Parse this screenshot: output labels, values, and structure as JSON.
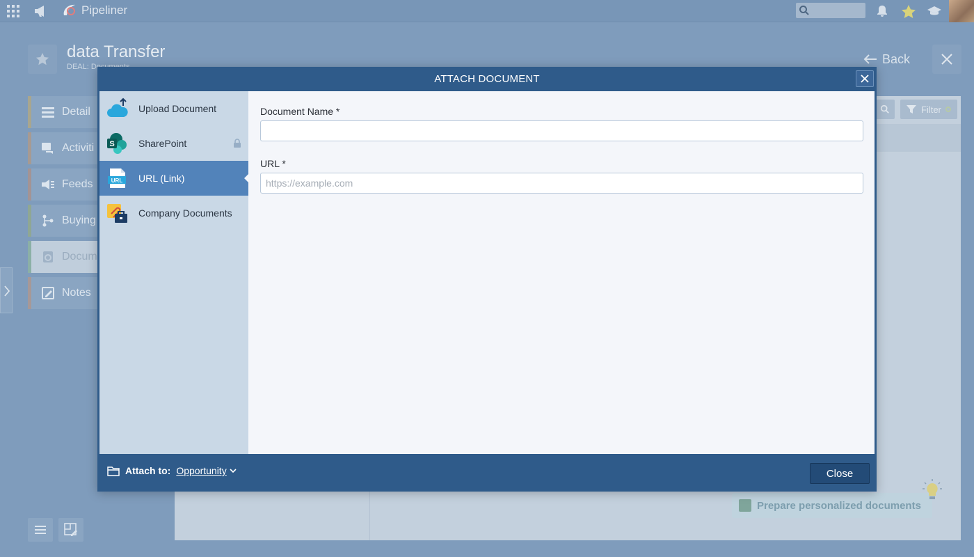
{
  "app": {
    "brand": "Pipeliner"
  },
  "page": {
    "title": "data Transfer",
    "subtitle": "DEAL: Documents",
    "back_label": "Back"
  },
  "side_nav": {
    "items": [
      {
        "label": "Detail",
        "icon": "list-icon"
      },
      {
        "label": "Activiti",
        "icon": "activities-icon"
      },
      {
        "label": "Feeds",
        "icon": "feeds-icon"
      },
      {
        "label": "Buying",
        "icon": "buying-center-icon"
      },
      {
        "label": "Docum",
        "icon": "documents-icon"
      },
      {
        "label": "Notes",
        "icon": "notes-icon"
      }
    ]
  },
  "content": {
    "filter_label": "Filter",
    "hint": "Prepare personalized documents"
  },
  "modal": {
    "title": "ATTACH DOCUMENT",
    "sources": [
      {
        "label": "Upload Document",
        "icon": "cloud-upload-icon"
      },
      {
        "label": "SharePoint",
        "icon": "sharepoint-icon"
      },
      {
        "label": "URL (Link)",
        "icon": "url-link-icon"
      },
      {
        "label": "Company Documents",
        "icon": "company-documents-icon"
      }
    ],
    "active_source": "URL (Link)",
    "form": {
      "doc_name_label": "Document Name *",
      "doc_name_value": "",
      "url_label": "URL *",
      "url_placeholder": "https://example.com",
      "url_value": ""
    },
    "footer": {
      "attach_label": "Attach to:",
      "attach_value": "Opportunity",
      "close_label": "Close"
    },
    "colors": {
      "header": "#2f5b8a",
      "active_item": "#5283ba",
      "source_bg": "#c9d8e6"
    }
  }
}
